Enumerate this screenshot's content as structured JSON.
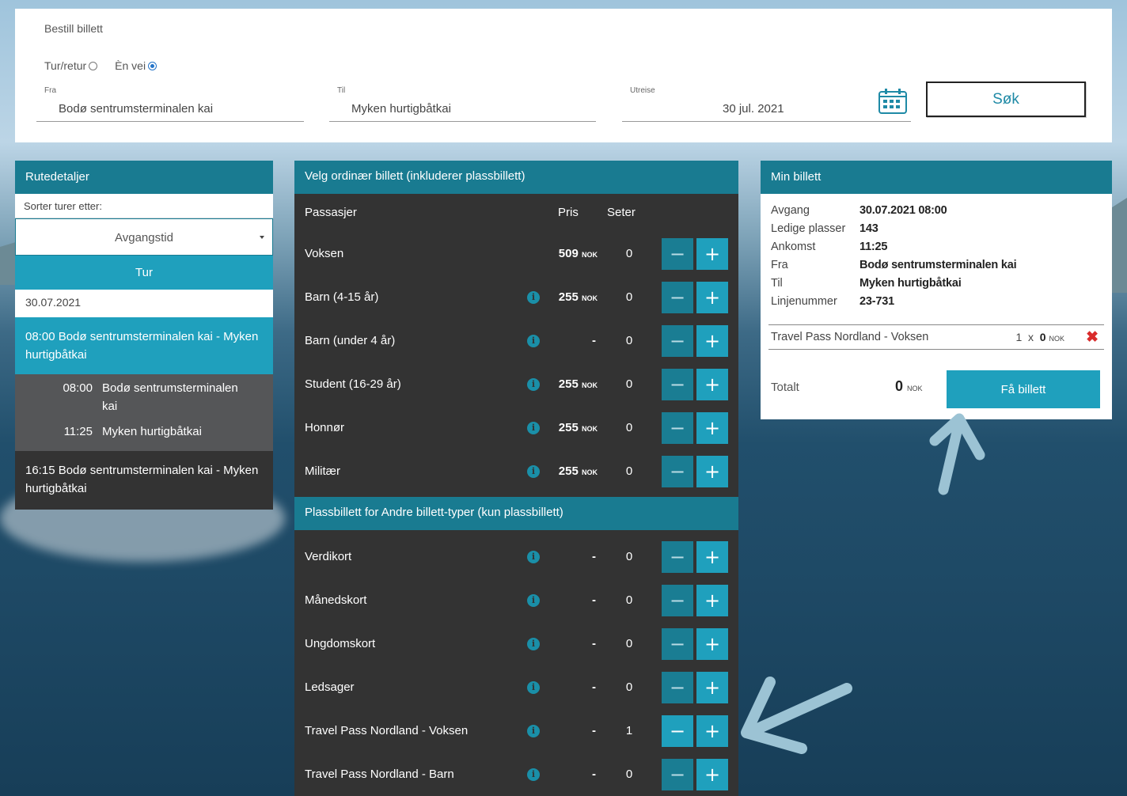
{
  "search": {
    "title": "Bestill billett",
    "trip_types": [
      {
        "label": "Tur/retur",
        "selected": false
      },
      {
        "label": "Èn vei",
        "selected": true
      }
    ],
    "from": {
      "label": "Fra",
      "value": "Bodø sentrumsterminalen kai"
    },
    "to": {
      "label": "Til",
      "value": "Myken hurtigbåtkai"
    },
    "departure": {
      "label": "Utreise",
      "value": "30 jul. 2021"
    },
    "search_button": "Søk"
  },
  "route_details": {
    "title": "Rutedetaljer",
    "sort_label": "Sorter turer etter:",
    "sort_value": "Avgangstid",
    "trips_header": "Tur",
    "date": "30.07.2021",
    "selected_trip": "08:00 Bodø sentrumsterminalen kai - Myken hurtigbåtkai",
    "selected_trip_stops": [
      {
        "time": "08:00",
        "place": "Bodø sentrumsterminalen kai"
      },
      {
        "time": "11:25",
        "place": "Myken hurtigbåtkai"
      }
    ],
    "other_trip": "16:15 Bodø sentrumsterminalen kai - Myken hurtigbåtkai"
  },
  "ordinary": {
    "title": "Velg ordinær billett (inkluderer plassbillett)",
    "columns": {
      "passenger": "Passasjer",
      "price": "Pris",
      "seats": "Seter"
    },
    "currency": "NOK",
    "rows": [
      {
        "name": "Voksen",
        "price": "509",
        "seats": "0",
        "info": false
      },
      {
        "name": "Barn (4-15 år)",
        "price": "255",
        "seats": "0",
        "info": true
      },
      {
        "name": "Barn (under 4 år)",
        "price": "-",
        "seats": "0",
        "info": true
      },
      {
        "name": "Student (16-29 år)",
        "price": "255",
        "seats": "0",
        "info": true
      },
      {
        "name": "Honnør",
        "price": "255",
        "seats": "0",
        "info": true
      },
      {
        "name": "Militær",
        "price": "255",
        "seats": "0",
        "info": true
      }
    ]
  },
  "other_types": {
    "title": "Plassbillett for Andre billett-typer (kun plassbillett)",
    "rows": [
      {
        "name": "Verdikort",
        "price": "-",
        "seats": "0",
        "info": true
      },
      {
        "name": "Månedskort",
        "price": "-",
        "seats": "0",
        "info": true
      },
      {
        "name": "Ungdomskort",
        "price": "-",
        "seats": "0",
        "info": true
      },
      {
        "name": "Ledsager",
        "price": "-",
        "seats": "0",
        "info": true
      },
      {
        "name": "Travel Pass Nordland - Voksen",
        "price": "-",
        "seats": "1",
        "info": true
      },
      {
        "name": "Travel Pass Nordland - Barn",
        "price": "-",
        "seats": "0",
        "info": true
      }
    ]
  },
  "my_ticket": {
    "title": "Min billett",
    "details": [
      {
        "label": "Avgang",
        "value": "30.07.2021 08:00"
      },
      {
        "label": "Ledige plasser",
        "value": "143"
      },
      {
        "label": "Ankomst",
        "value": "11:25"
      },
      {
        "label": "Fra",
        "value": "Bodø sentrumsterminalen kai"
      },
      {
        "label": "Til",
        "value": "Myken hurtigbåtkai"
      },
      {
        "label": "Linjenummer",
        "value": "23-731"
      }
    ],
    "line_item": {
      "name": "Travel Pass Nordland - Voksen",
      "qty": "1",
      "times": "x",
      "price": "0",
      "currency": "NOK"
    },
    "total_label": "Totalt",
    "total_value": "0",
    "total_currency": "NOK",
    "get_ticket_button": "Få billett"
  },
  "symbols": {
    "minus": "−",
    "plus": "+",
    "info": "i",
    "remove": "✖"
  },
  "colors": {
    "teal_dark": "#197b91",
    "teal": "#1fa0bd",
    "panel_dark": "#333333",
    "remove_red": "#d92b2b",
    "arrow": "#9cc3d4"
  }
}
